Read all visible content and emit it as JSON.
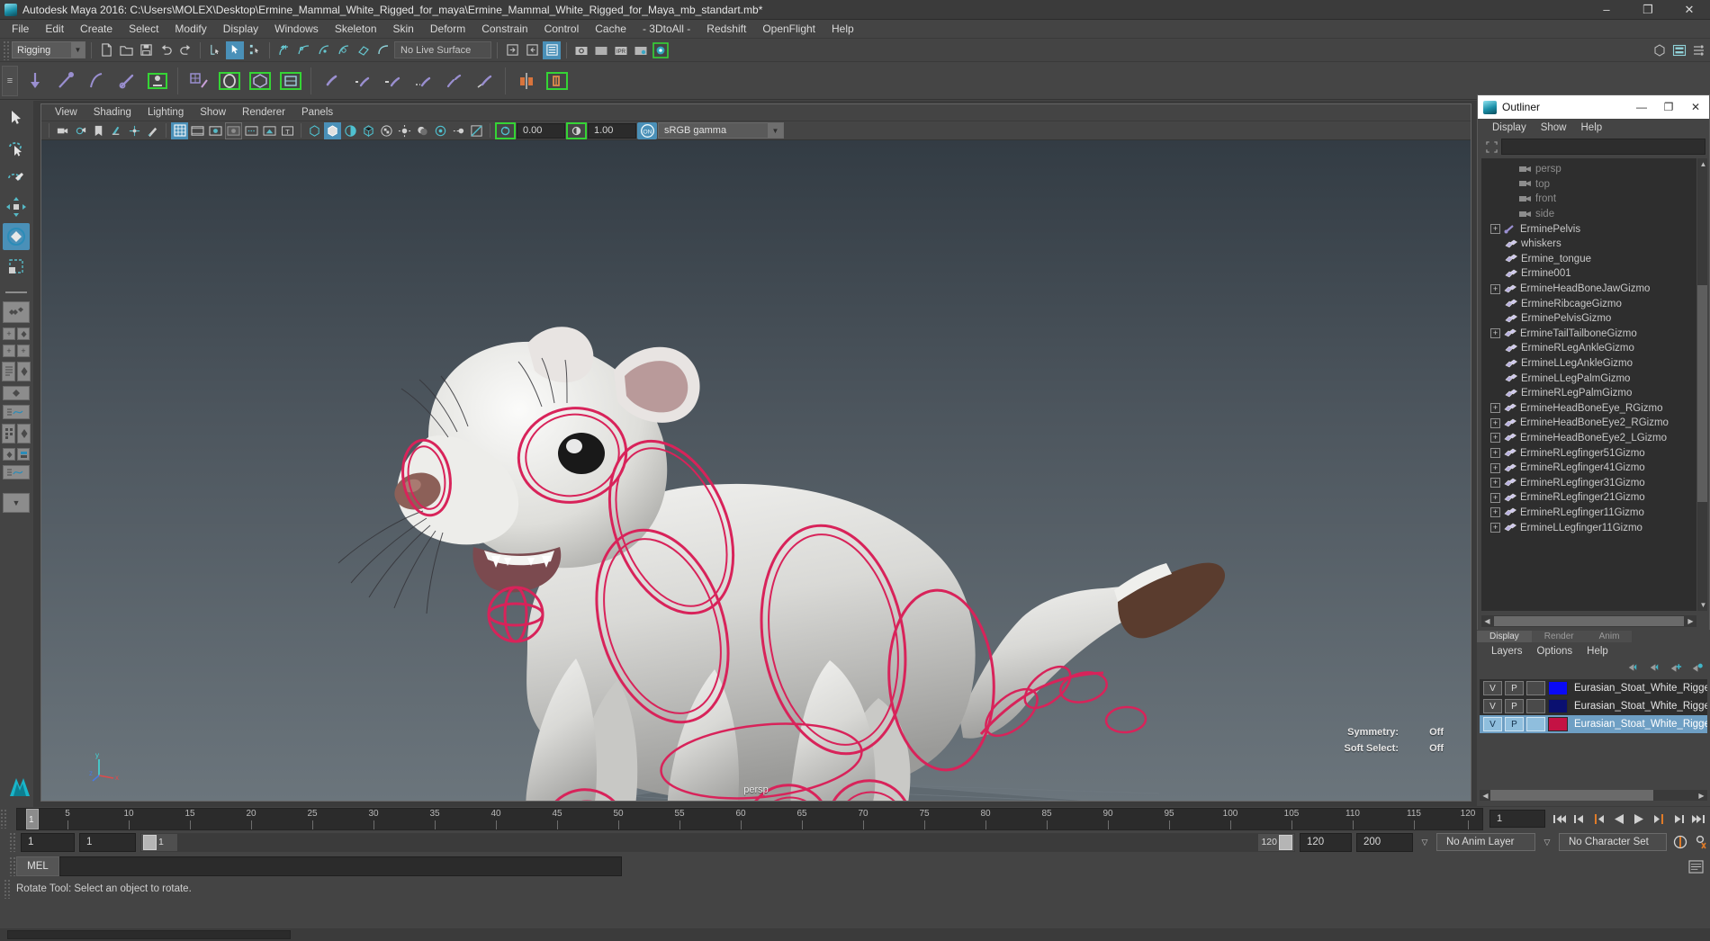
{
  "window": {
    "title": "Autodesk Maya 2016: C:\\Users\\MOLEX\\Desktop\\Ermine_Mammal_White_Rigged_for_maya\\Ermine_Mammal_White_Rigged_for_Maya_mb_standart.mb*",
    "minimize": "–",
    "maximize": "❐",
    "close": "✕"
  },
  "menubar": {
    "items": [
      "File",
      "Edit",
      "Create",
      "Select",
      "Modify",
      "Display",
      "Windows",
      "Skeleton",
      "Skin",
      "Deform",
      "Constrain",
      "Control",
      "Cache",
      "- 3DtoAll -",
      "Redshift",
      "OpenFlight",
      "Help"
    ]
  },
  "statusline": {
    "menuset": "Rigging",
    "live_surface": "No Live Surface"
  },
  "viewport": {
    "menus": [
      "View",
      "Shading",
      "Lighting",
      "Show",
      "Renderer",
      "Panels"
    ],
    "exposure": "0.00",
    "gamma": "1.00",
    "color_profile": "sRGB gamma",
    "camera_label": "persp",
    "hud": [
      {
        "label": "Symmetry:",
        "value": "Off"
      },
      {
        "label": "Soft Select:",
        "value": "Off"
      }
    ],
    "axis": {
      "x": "x",
      "y": "y",
      "z": "z"
    }
  },
  "outliner": {
    "title": "Outliner",
    "menus": [
      "Display",
      "Show",
      "Help"
    ],
    "search_value": "",
    "search_placeholder": "",
    "items": [
      {
        "label": "persp",
        "type": "camera",
        "expand": false,
        "depth": 1
      },
      {
        "label": "top",
        "type": "camera",
        "expand": false,
        "depth": 1
      },
      {
        "label": "front",
        "type": "camera",
        "expand": false,
        "depth": 1
      },
      {
        "label": "side",
        "type": "camera",
        "expand": false,
        "depth": 1
      },
      {
        "label": "ErminePelvis",
        "type": "joint",
        "expand": true,
        "depth": 0
      },
      {
        "label": "whiskers",
        "type": "mesh",
        "expand": false,
        "depth": 0
      },
      {
        "label": "Ermine_tongue",
        "type": "mesh",
        "expand": false,
        "depth": 0
      },
      {
        "label": "Ermine001",
        "type": "mesh",
        "expand": false,
        "depth": 0
      },
      {
        "label": "ErmineHeadBoneJawGizmo",
        "type": "mesh",
        "expand": true,
        "depth": 0
      },
      {
        "label": "ErmineRibcageGizmo",
        "type": "mesh",
        "expand": false,
        "depth": 0
      },
      {
        "label": "ErminePelvisGizmo",
        "type": "mesh",
        "expand": false,
        "depth": 0
      },
      {
        "label": "ErmineTailTailboneGizmo",
        "type": "mesh",
        "expand": true,
        "depth": 0
      },
      {
        "label": "ErmineRLegAnkleGizmo",
        "type": "mesh",
        "expand": false,
        "depth": 0
      },
      {
        "label": "ErmineLLegAnkleGizmo",
        "type": "mesh",
        "expand": false,
        "depth": 0
      },
      {
        "label": "ErmineLLegPalmGizmo",
        "type": "mesh",
        "expand": false,
        "depth": 0
      },
      {
        "label": "ErmineRLegPalmGizmo",
        "type": "mesh",
        "expand": false,
        "depth": 0
      },
      {
        "label": "ErmineHeadBoneEye_RGizmo",
        "type": "mesh",
        "expand": true,
        "depth": 0
      },
      {
        "label": "ErmineHeadBoneEye2_RGizmo",
        "type": "mesh",
        "expand": true,
        "depth": 0
      },
      {
        "label": "ErmineHeadBoneEye2_LGizmo",
        "type": "mesh",
        "expand": true,
        "depth": 0
      },
      {
        "label": "ErmineRLegfinger51Gizmo",
        "type": "mesh",
        "expand": true,
        "depth": 0
      },
      {
        "label": "ErmineRLegfinger41Gizmo",
        "type": "mesh",
        "expand": true,
        "depth": 0
      },
      {
        "label": "ErmineRLegfinger31Gizmo",
        "type": "mesh",
        "expand": true,
        "depth": 0
      },
      {
        "label": "ErmineRLegfinger21Gizmo",
        "type": "mesh",
        "expand": true,
        "depth": 0
      },
      {
        "label": "ErmineRLegfinger11Gizmo",
        "type": "mesh",
        "expand": true,
        "depth": 0
      },
      {
        "label": "ErmineLLegfinger11Gizmo",
        "type": "mesh",
        "expand": true,
        "depth": 0
      }
    ]
  },
  "layer_editor": {
    "tabs": [
      {
        "label": "Display",
        "active": true
      },
      {
        "label": "Render",
        "active": false
      },
      {
        "label": "Anim",
        "active": false
      }
    ],
    "menus": [
      "Layers",
      "Options",
      "Help"
    ],
    "rows": [
      {
        "v": "V",
        "p": "P",
        "third": "",
        "color": "#0a0af5",
        "name": "Eurasian_Stoat_White_Rigged",
        "selected": false
      },
      {
        "v": "V",
        "p": "P",
        "third": "",
        "color": "#0a1070",
        "name": "Eurasian_Stoat_White_Rigged_B",
        "selected": false
      },
      {
        "v": "V",
        "p": "P",
        "third": "",
        "color": "#c41244",
        "name": "Eurasian_Stoat_White_Rigged_C",
        "selected": true
      }
    ]
  },
  "timeline": {
    "start_frame": "1",
    "end_frame": "120",
    "current_frame": "1",
    "current_frame_field": "1",
    "ticks": [
      5,
      10,
      15,
      20,
      25,
      30,
      35,
      40,
      45,
      50,
      55,
      60,
      65,
      70,
      75,
      80,
      85,
      90,
      95,
      100,
      105,
      110,
      115,
      120
    ],
    "range_start": "1",
    "range_end": "120",
    "anim_start": "1",
    "anim_end": "120",
    "playback_end": "200",
    "anim_layer": "No Anim Layer",
    "character_set": "No Character Set"
  },
  "command_line": {
    "label": "MEL",
    "value": "",
    "help_text": "Rotate Tool: Select an object to rotate."
  },
  "colors": {
    "accent_blue": "#4a90b8",
    "highlight_green": "#35d435",
    "orange": "#e07b28",
    "rig_red": "#d8235a"
  }
}
